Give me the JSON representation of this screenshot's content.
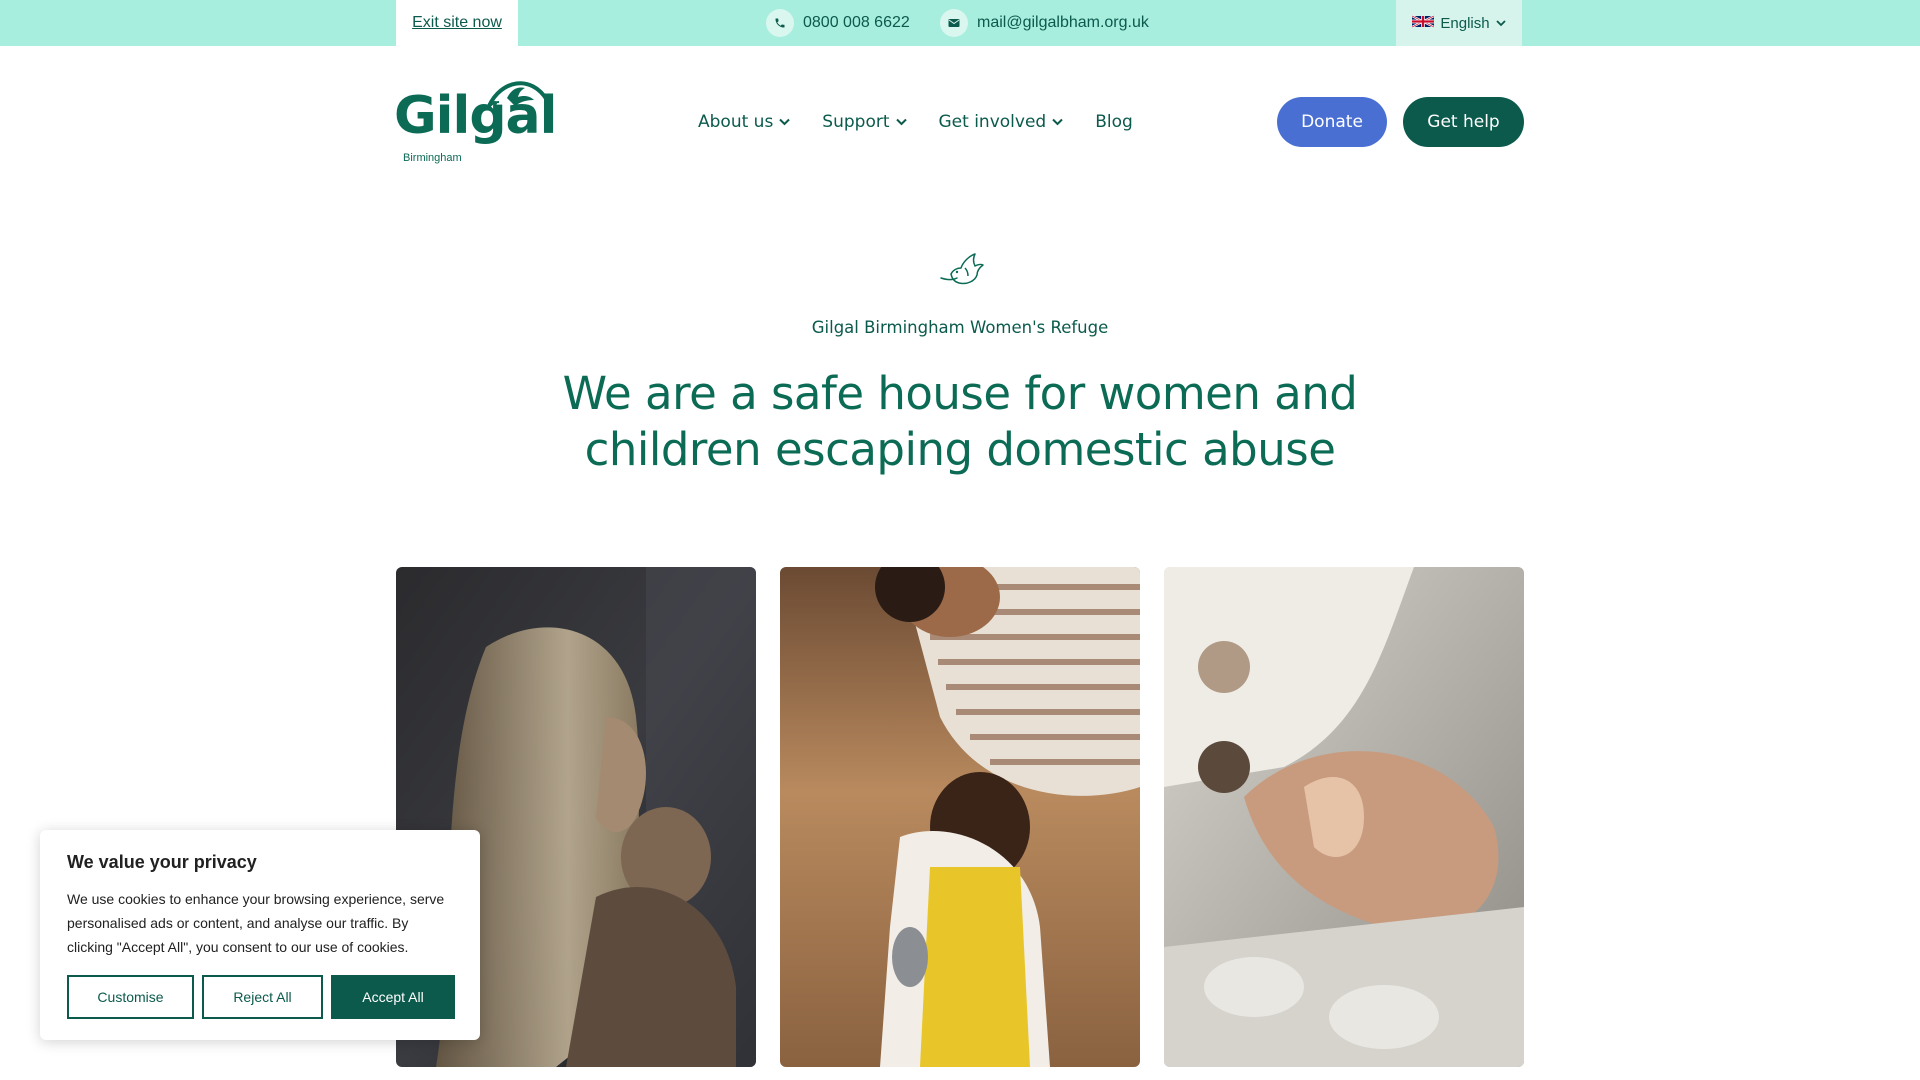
{
  "topbar": {
    "exit_label": "Exit site now",
    "phone": "0800 008 6622",
    "email": "mail@gilgalbham.org.uk",
    "language": "English"
  },
  "logo": {
    "wordmark": "Gilgal",
    "subtitle": "Birmingham"
  },
  "nav": {
    "items": [
      {
        "label": "About us",
        "has_dropdown": true
      },
      {
        "label": "Support",
        "has_dropdown": true
      },
      {
        "label": "Get involved",
        "has_dropdown": true
      },
      {
        "label": "Blog",
        "has_dropdown": false
      }
    ]
  },
  "actions": {
    "donate_label": "Donate",
    "help_label": "Get help"
  },
  "hero": {
    "eyebrow": "Gilgal Birmingham Women's Refuge",
    "headline": "We are a safe house for women and children escaping domestic abuse"
  },
  "photos": [
    {
      "icon": "photo-mother-holding-child"
    },
    {
      "icon": "photo-woman-and-girl-playing"
    },
    {
      "icon": "photo-baby-hand-in-adult-hands"
    }
  ],
  "cookie": {
    "title": "We value your privacy",
    "text": "We use cookies to enhance your browsing experience, serve personalised ads or content, and analyse our traffic. By clicking \"Accept All\", you consent to our use of cookies.",
    "customise_label": "Customise",
    "reject_label": "Reject All",
    "accept_label": "Accept All"
  },
  "colors": {
    "topbar": "#a8eedf",
    "brand_green": "#0b5a4c",
    "donate_blue": "#4a6fd3"
  }
}
